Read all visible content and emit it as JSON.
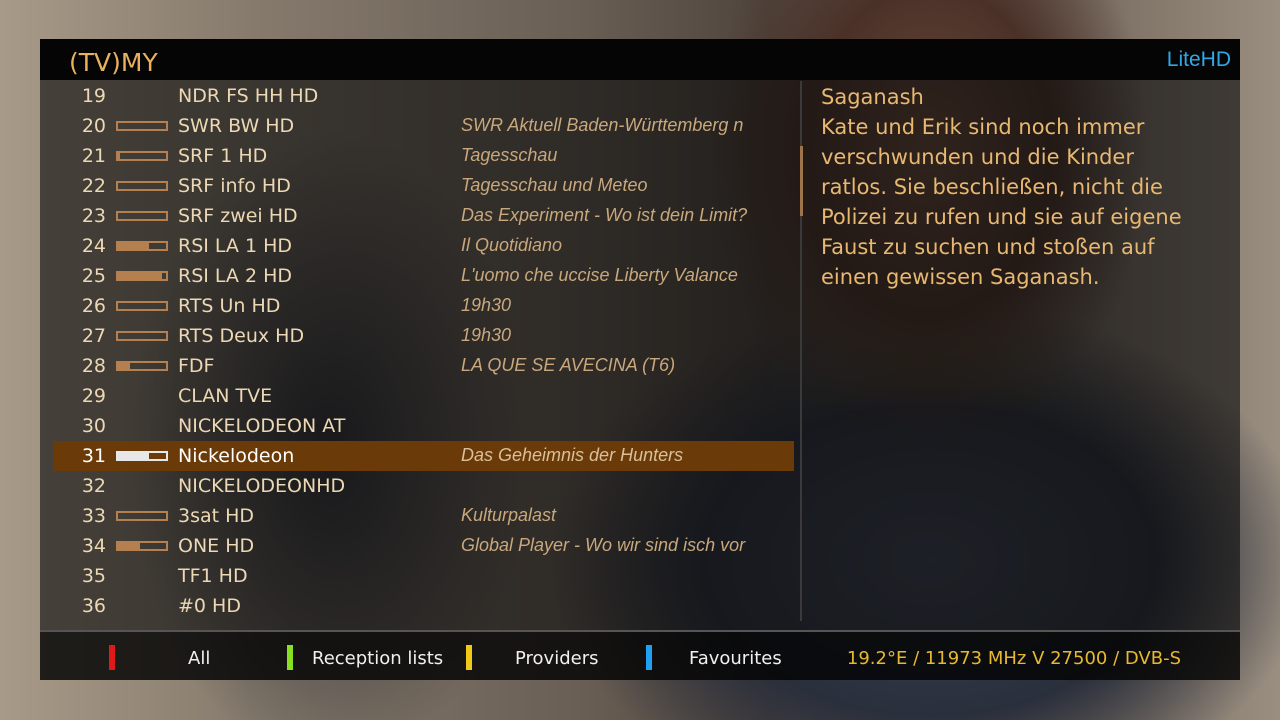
{
  "header": {
    "logo": "(TV)MY",
    "skin": "LiteHD"
  },
  "channels": [
    {
      "num": "19",
      "name": "NDR FS HH HD",
      "event": "",
      "progress": null
    },
    {
      "num": "20",
      "name": "SWR BW HD",
      "event": "SWR Aktuell Baden-Württemberg n",
      "progress": 0.0
    },
    {
      "num": "21",
      "name": "SRF 1 HD",
      "event": "Tagesschau",
      "progress": 0.05
    },
    {
      "num": "22",
      "name": "SRF info HD",
      "event": "Tagesschau und Meteo",
      "progress": 0.0
    },
    {
      "num": "23",
      "name": "SRF zwei HD",
      "event": "Das Experiment - Wo ist dein Limit?",
      "progress": 0.0
    },
    {
      "num": "24",
      "name": "RSI LA 1 HD",
      "event": "Il Quotidiano",
      "progress": 0.65
    },
    {
      "num": "25",
      "name": "RSI LA 2 HD",
      "event": "L'uomo che uccise Liberty Valance",
      "progress": 0.92
    },
    {
      "num": "26",
      "name": "RTS Un HD",
      "event": "19h30",
      "progress": 0.0
    },
    {
      "num": "27",
      "name": "RTS Deux HD",
      "event": "19h30",
      "progress": 0.0
    },
    {
      "num": "28",
      "name": "FDF",
      "event": "LA QUE SE AVECINA (T6)",
      "progress": 0.25
    },
    {
      "num": "29",
      "name": "CLAN  TVE",
      "event": "",
      "progress": null
    },
    {
      "num": "30",
      "name": "NICKELODEON AT",
      "event": "",
      "progress": null
    },
    {
      "num": "31",
      "name": "Nickelodeon",
      "event": "Das Geheimnis der Hunters",
      "progress": 0.65,
      "selected": true
    },
    {
      "num": "32",
      "name": "NICKELODEONHD",
      "event": "",
      "progress": null
    },
    {
      "num": "33",
      "name": "3sat HD",
      "event": "Kulturpalast",
      "progress": 0.0
    },
    {
      "num": "34",
      "name": "ONE HD",
      "event": "Global Player - Wo wir sind isch vor",
      "progress": 0.45
    },
    {
      "num": "35",
      "name": "TF1 HD",
      "event": "",
      "progress": null
    },
    {
      "num": "36",
      "name": "#0 HD",
      "event": "",
      "progress": null
    }
  ],
  "description": {
    "lines": [
      "Saganash",
      "Kate und Erik sind noch immer",
      "verschwunden und die Kinder",
      "ratlos. Sie beschließen, nicht die",
      "Polizei zu rufen und sie auf eigene",
      "Faust zu suchen und stoßen auf",
      "einen gewissen Saganash."
    ]
  },
  "footer": {
    "keys": [
      {
        "color": "#e01818",
        "label": "All"
      },
      {
        "color": "#88e020",
        "label": "Reception lists"
      },
      {
        "color": "#f0c818",
        "label": "Providers"
      },
      {
        "color": "#20a0f0",
        "label": "Favourites"
      }
    ],
    "tuner_info": "19.2°E / 11973 MHz V 27500 / DVB-S"
  }
}
